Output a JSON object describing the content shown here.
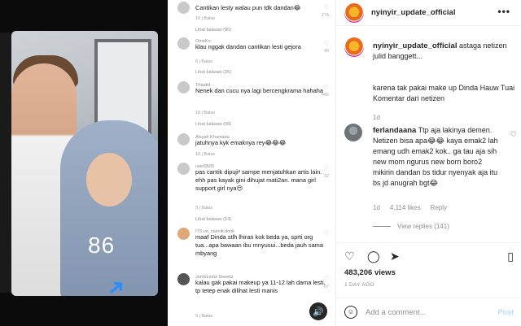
{
  "media": {
    "video_counter": "86",
    "comments": [
      {
        "name": "",
        "text": "Cantikan lesty walau pun tdk dandan😂",
        "meta": "10 j   Balas",
        "hearts": "274",
        "see": "Lihat balasan (90)"
      },
      {
        "name": "OmeKo",
        "text": "klau nggak dandan cantikan lesti gejora",
        "meta": "6 j   Balas",
        "hearts": "48",
        "see": "Lihat balasan (26)"
      },
      {
        "name": "Trhadid",
        "text": "Nenek dan cucu nya lagi bercengkrama hahaha",
        "meta": "10 j   Balas",
        "hearts": "445",
        "see": "Lihat balasan (68)"
      },
      {
        "name": "Aisyah Khumaira",
        "text": "jatuhnya kyk emaknya rey😂😂😂",
        "meta": "10 j   Balas",
        "hearts": "",
        "see": ""
      },
      {
        "name": "user9509",
        "text": "pas cantik dipuji² sampe menjatuhkan artis lain. ehh pas kayak gini dihujat mati2an. mana girl support girl nya😒",
        "meta": "9 j   Balas",
        "hearts": "32",
        "see": "Lihat balasan (14)"
      },
      {
        "name": "ITS.ve_ciamik.donk",
        "text": "maaf Dinda stlh lhiran kok beda ya, sprti org tua...apa bawaan ibu mnyusui...beda jauh sama mbyang",
        "meta": "",
        "hearts": "",
        "see": ""
      },
      {
        "name": "JembLemz Sweetz",
        "text": "kalau gak pakai makeup ya 11-12 lah dama lesti, tp tetep enak dilihat lesti manis",
        "meta": "9 j   Balas",
        "hearts": "67",
        "see": ""
      }
    ]
  },
  "header": {
    "username": "nyinyir_update_official",
    "more_label": "•••"
  },
  "caption": {
    "username": "nyinyir_update_official",
    "text": "astaga netizen julid banggett...",
    "paragraph2": "karena tak pakai make up Dinda Hauw Tuai Komentar dari netizen",
    "age": "1d"
  },
  "comment": {
    "username": "ferlandaana",
    "text": "Ttp aja lakinya demen. Netizen bisa apa😂😂 kaya emak2 lah emang udh emak2 kok.. ga tau aja sih new mom ngurus new born boro2 mikirin dandan bs tidur nyenyak aja itu bs jd anugrah bgt😂",
    "age": "1d",
    "likes": "4,114 likes",
    "reply_label": "Reply",
    "view_replies": "View replies (141)"
  },
  "post": {
    "views": "483,206 views",
    "posted": "1 DAY AGO"
  },
  "add_comment": {
    "placeholder": "Add a comment...",
    "post_label": "Post"
  },
  "icons": {
    "heart": "heart-icon",
    "comment": "comment-icon",
    "share": "share-icon",
    "save": "bookmark-icon",
    "emoji": "emoji-icon",
    "sound": "speaker-icon"
  }
}
